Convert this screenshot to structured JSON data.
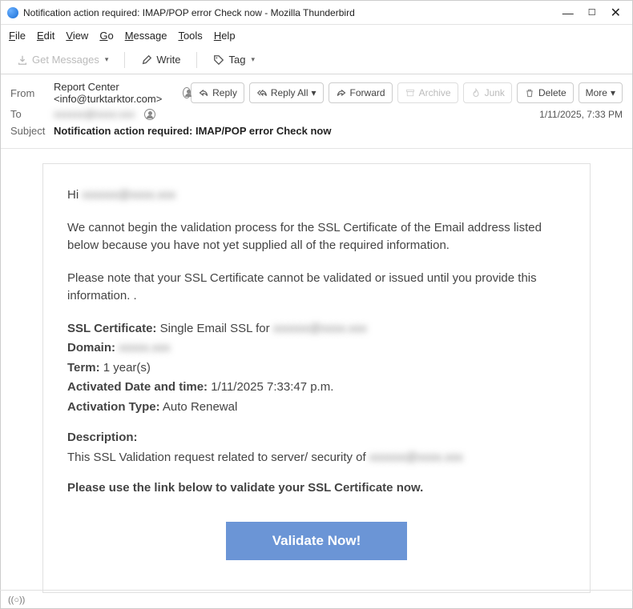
{
  "window": {
    "title": "Notification action required: IMAP/POP error Check now - Mozilla Thunderbird"
  },
  "menu": {
    "file": "File",
    "edit": "Edit",
    "view": "View",
    "go": "Go",
    "message": "Message",
    "tools": "Tools",
    "help": "Help"
  },
  "toolbar": {
    "get_messages": "Get Messages",
    "write": "Write",
    "tag": "Tag"
  },
  "headers": {
    "from_label": "From",
    "from_value": "Report Center <info@turktarktor.com>",
    "to_label": "To",
    "to_value": "xxxxxx@xxxx.xxx",
    "subject_label": "Subject",
    "subject_value": "Notification action required: IMAP/POP error Check now",
    "timestamp": "1/11/2025, 7:33 PM"
  },
  "actions": {
    "reply": "Reply",
    "reply_all": "Reply All",
    "forward": "Forward",
    "archive": "Archive",
    "junk": "Junk",
    "delete": "Delete",
    "more": "More"
  },
  "email": {
    "greeting": "Hi",
    "greeting_blur": "xxxxxx@xxxx.xxx",
    "p1": "We cannot begin the validation process for the SSL Certificate of the Email address listed below because you have not yet supplied all of the required information.",
    "p2": "Please note that your SSL Certificate cannot be validated or issued until you provide this information. .",
    "ssl_cert_label": "SSL Certificate:",
    "ssl_cert_value": "Single Email SSL for",
    "ssl_cert_blur": "xxxxxx@xxxx.xxx",
    "domain_label": "Domain:",
    "domain_blur": "xxxxx.xxx",
    "term_label": "Term:",
    "term_value": "1 year(s)",
    "act_date_label": "Activated Date and time:",
    "act_date_value": "1/11/2025 7:33:47 p.m.",
    "act_type_label": "Activation Type:",
    "act_type_value": "Auto Renewal",
    "desc_label": "Description:",
    "desc_text": "This SSL Validation request related to server/ security of",
    "desc_blur": "xxxxxx@xxxx.xxx",
    "cta_prompt": "Please use the link below to validate your SSL Certificate now.",
    "cta_button": "Validate Now!"
  },
  "status": {
    "indicator": "((○))"
  }
}
